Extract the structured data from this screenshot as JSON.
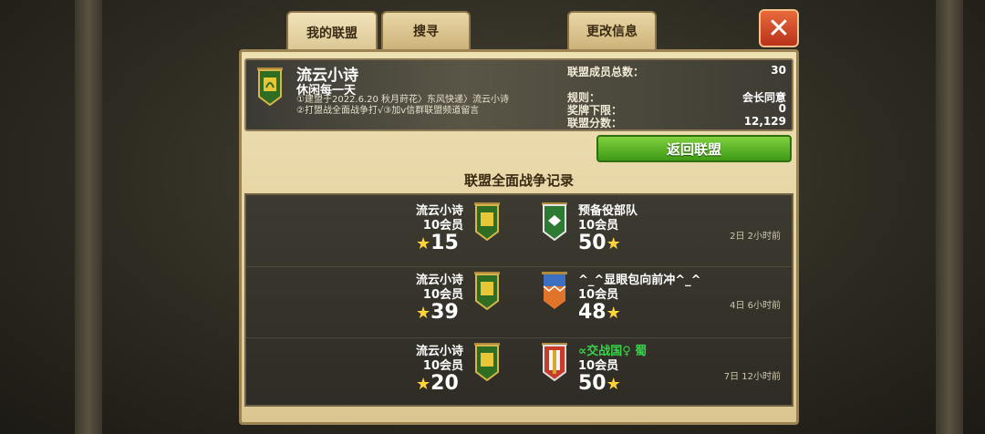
{
  "tabs": [
    {
      "label": "我的联盟"
    },
    {
      "label": "搜寻"
    },
    {
      "label": "更改信息"
    }
  ],
  "close_label": "✕",
  "alliance": {
    "name": "流云小诗",
    "slogan": "休闲每一天",
    "description": "①建盟于2022.6.20 秋月莳花〉东风快递〉流云小诗 ②打盟战全面战争打√③加v信群联盟频道留言",
    "stats": [
      {
        "label": "联盟成员总数：",
        "value": "30"
      },
      {
        "label": "规则：",
        "value": "会长同意"
      },
      {
        "label": "奖牌下限：",
        "value": "0"
      },
      {
        "label": "联盟分数：",
        "value": "12,129"
      }
    ]
  },
  "return_button": "返回联盟",
  "section_title": "联盟全面战争记录",
  "records": [
    {
      "left_name": "流云小诗",
      "left_members": "10会员",
      "left_score": "15",
      "right_name": "预备役部队",
      "right_members": "10会员",
      "right_score": "50",
      "time": "2日 2小时前"
    },
    {
      "left_name": "流云小诗",
      "left_members": "10会员",
      "left_score": "39",
      "right_name": "^_^显眼包向前冲^_^",
      "right_members": "10会员",
      "right_score": "48",
      "time": "4日 6小时前"
    },
    {
      "left_name": "流云小诗",
      "left_members": "10会员",
      "left_score": "20",
      "right_name": "∝交战国♀ 蜀",
      "right_members": "10会员",
      "right_score": "50",
      "time": "7日 12小时前"
    }
  ],
  "colors": {
    "accent_green": "#3f9a16",
    "enemy_name_highlight": "#39d24a",
    "star": "#ffd43a"
  }
}
